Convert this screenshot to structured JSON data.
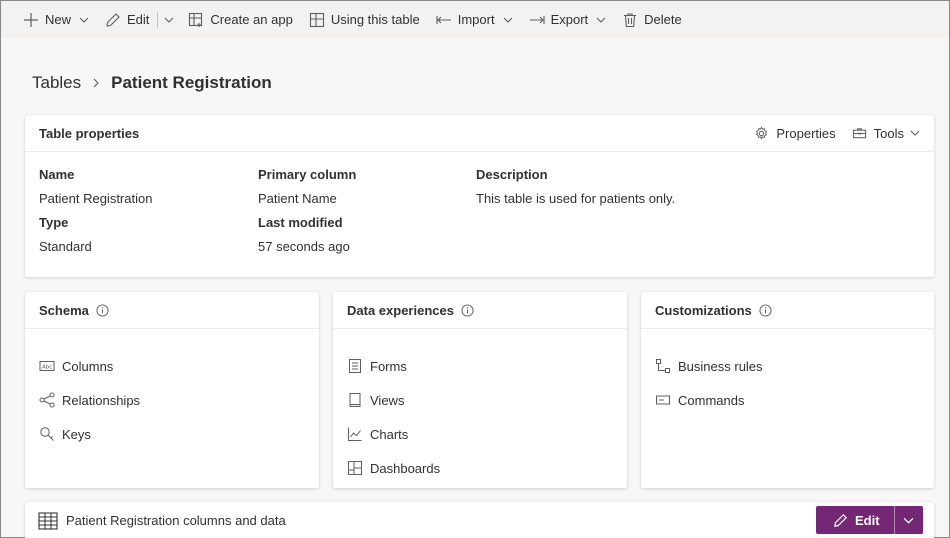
{
  "toolbar": {
    "new": "New",
    "edit": "Edit",
    "create_app": "Create an app",
    "using_table": "Using this table",
    "import": "Import",
    "export": "Export",
    "delete": "Delete"
  },
  "breadcrumb": {
    "parent": "Tables",
    "current": "Patient Registration"
  },
  "table_properties": {
    "title": "Table properties",
    "properties_button": "Properties",
    "tools_button": "Tools",
    "name_label": "Name",
    "name_value": "Patient Registration",
    "type_label": "Type",
    "type_value": "Standard",
    "primary_label": "Primary column",
    "primary_value": "Patient Name",
    "modified_label": "Last modified",
    "modified_value": "57 seconds ago",
    "description_label": "Description",
    "description_value": "This table is used for patients only."
  },
  "schema": {
    "title": "Schema",
    "items": [
      "Columns",
      "Relationships",
      "Keys"
    ]
  },
  "data_experiences": {
    "title": "Data experiences",
    "items": [
      "Forms",
      "Views",
      "Charts",
      "Dashboards"
    ]
  },
  "customizations": {
    "title": "Customizations",
    "items": [
      "Business rules",
      "Commands"
    ]
  },
  "columns_data": {
    "title": "Patient Registration columns and data",
    "edit_button": "Edit"
  },
  "colors": {
    "accent": "#742774",
    "toolbar_bg": "#f3f2f1",
    "page_bg": "#f7f7f7"
  }
}
